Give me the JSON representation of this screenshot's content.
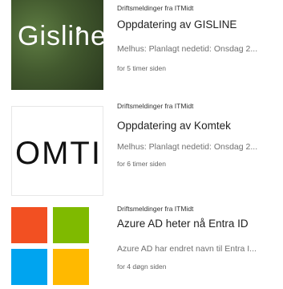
{
  "feed": {
    "items": [
      {
        "source": "Driftsmeldinger fra ITMidt",
        "title": "Oppdatering av GISLINE",
        "snippet": "Melhus: Planlagt nedetid: Onsdag 2...",
        "time": "for 5 timer siden",
        "thumbnail": {
          "logo_text": "Gisline",
          "background": "#42592e"
        }
      },
      {
        "source": "Driftsmeldinger fra ITMidt",
        "title": "Oppdatering av Komtek",
        "snippet": "Melhus: Planlagt nedetid: Onsdag 2...",
        "time": "for 6 timer siden",
        "thumbnail": {
          "logo_text": "OMTI",
          "background": "#ffffff"
        }
      },
      {
        "source": "Driftsmeldinger fra ITMidt",
        "title": "Azure AD heter nå Entra ID",
        "snippet": "Azure AD har endret navn til Entra I...",
        "time": "for 4 døgn siden",
        "thumbnail": {
          "tile_colors": [
            "#f25022",
            "#7fba00",
            "#00a4ef",
            "#ffb900"
          ]
        }
      }
    ]
  },
  "theme": {
    "title_color": "#1f1f1f",
    "snippet_color": "#707070",
    "source_color": "#333333",
    "time_color": "#666666"
  }
}
